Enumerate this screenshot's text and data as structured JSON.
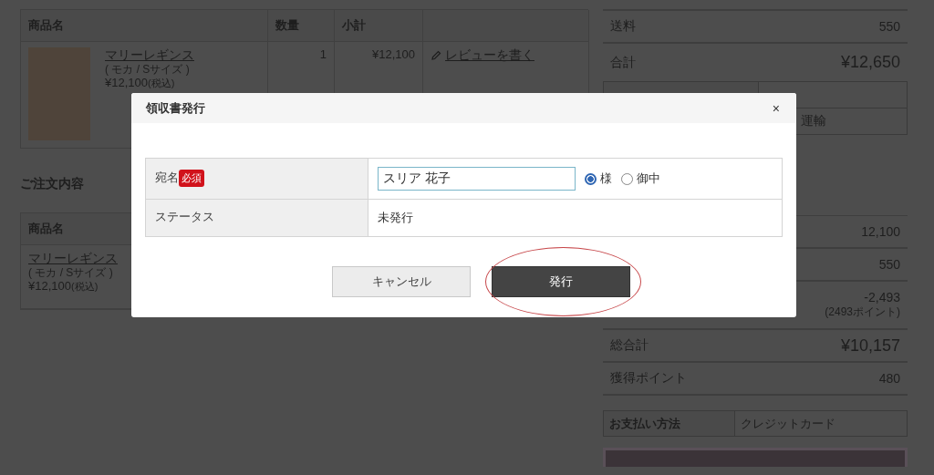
{
  "order_table": {
    "columns": [
      "商品名",
      "数量",
      "小計"
    ],
    "rows": [
      {
        "name": "マリーレギンス",
        "variant": "( モカ / Sサイズ )",
        "price": "¥12,100",
        "tax_note": "(税込)",
        "quantity": "1",
        "subtotal": "¥12,100",
        "review_link": "レビューを書く"
      }
    ]
  },
  "order_contents": {
    "heading": "ご注文内容",
    "column": "商品名",
    "items": [
      {
        "name": "マリーレギンス",
        "variant": "( モカ / Sサイズ )",
        "price": "¥12,100",
        "tax_note": "(税込)"
      }
    ]
  },
  "summary_top": [
    {
      "label": "送料",
      "value": "550",
      "kind": "plain"
    },
    {
      "label": "合計",
      "value": "¥12,650",
      "kind": "total"
    }
  ],
  "shipping": {
    "value": "運輸"
  },
  "summary": [
    {
      "value": "12,100",
      "kind": "plain"
    },
    {
      "value": "550",
      "kind": "plain"
    },
    {
      "value": "-2,493",
      "note": "(2493ポイント)",
      "kind": "plain"
    },
    {
      "label": "総合計",
      "value": "¥10,157",
      "kind": "total"
    },
    {
      "label": "獲得ポイント",
      "value": "480",
      "kind": "plain"
    }
  ],
  "payment": {
    "label": "お支払い方法",
    "value": "クレジットカード"
  },
  "modal": {
    "title": "領収書発行",
    "close": "×",
    "rows": [
      {
        "kind": "name",
        "label": "宛名",
        "badge": "必須",
        "value": "スリア 花子",
        "honorifics": [
          {
            "label": "様",
            "selected": true
          },
          {
            "label": "御中",
            "selected": false
          }
        ]
      },
      {
        "kind": "text",
        "label": "ステータス",
        "value": "未発行"
      }
    ],
    "buttons": [
      {
        "label": "キャンセル",
        "kind": "secondary",
        "highlighted": false
      },
      {
        "label": "発行",
        "kind": "primary",
        "highlighted": true
      }
    ]
  }
}
